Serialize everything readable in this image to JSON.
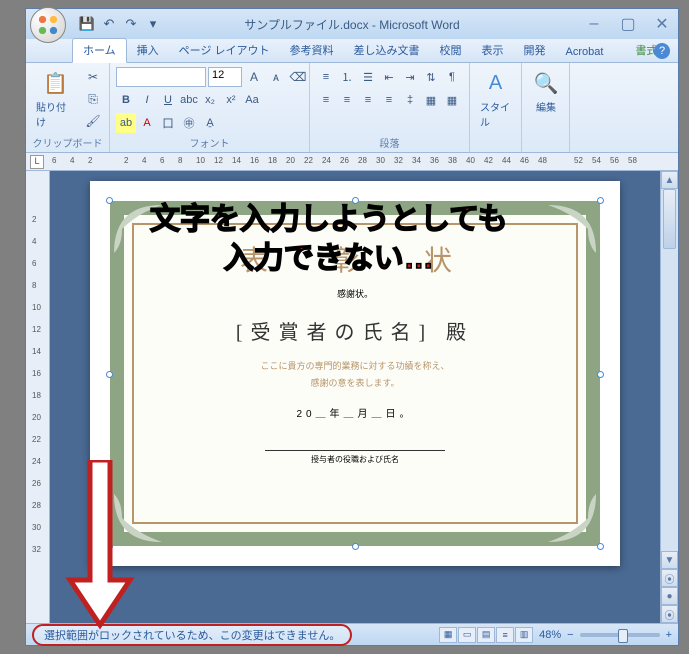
{
  "title": "サンプルファイル.docx - Microsoft Word",
  "tabs": {
    "home": "ホーム",
    "insert": "挿入",
    "page_layout": "ページ レイアウト",
    "references": "参考資料",
    "mailings": "差し込み文書",
    "review": "校閲",
    "view": "表示",
    "developer": "開発",
    "acrobat": "Acrobat",
    "format": "書式"
  },
  "ribbon": {
    "clipboard": {
      "label": "クリップボード",
      "paste": "貼り付け"
    },
    "font": {
      "label": "フォント",
      "size": "12"
    },
    "paragraph": {
      "label": "段落"
    },
    "styles": {
      "label": "スタイル"
    },
    "editing": {
      "label": "編集"
    }
  },
  "document": {
    "title": "表　彰　状",
    "subtitle": "感謝状。",
    "recipient": "[受賞者の氏名] 殿",
    "body1": "ここに貴方の専門的業務に対する功績を称え、",
    "body2": "感謝の意を表します。",
    "date": "20＿年＿月＿日。",
    "signature": "授与者の役職および氏名"
  },
  "status": {
    "message": "選択範囲がロックされているため、この変更はできません。",
    "zoom": "48%"
  },
  "annotation": {
    "line1": "文字を入力しようとしても",
    "line2": "入力できない…"
  },
  "ruler_h": [
    6,
    4,
    2,
    "",
    2,
    4,
    6,
    8,
    10,
    12,
    14,
    16,
    18,
    20,
    22,
    24,
    26,
    28,
    30,
    32,
    34,
    36,
    38,
    40,
    42,
    44,
    46,
    48,
    "",
    52,
    54,
    56,
    58
  ],
  "ruler_v": [
    "",
    "",
    2,
    4,
    6,
    8,
    10,
    12,
    14,
    16,
    18,
    20,
    22,
    24,
    26,
    28,
    30,
    32
  ]
}
